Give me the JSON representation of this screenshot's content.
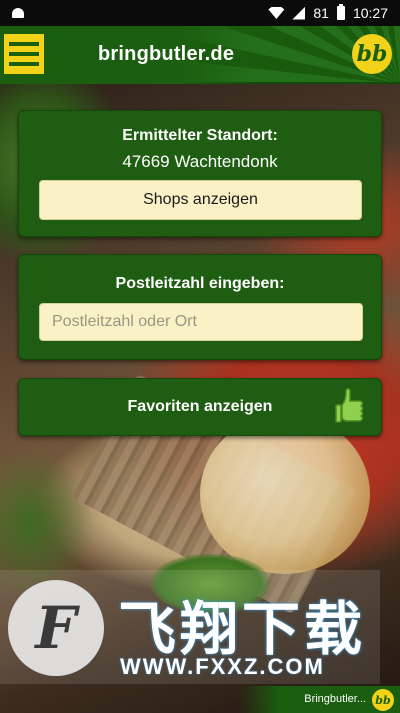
{
  "status_bar": {
    "battery": "81",
    "time": "10:27"
  },
  "header": {
    "title": "bringbutler.de",
    "logo_text": "bb"
  },
  "location_card": {
    "title": "Ermittelter Standort:",
    "location": "47669 Wachtendonk",
    "button_label": "Shops anzeigen"
  },
  "plz_card": {
    "title": "Postleitzahl eingeben:",
    "input_placeholder": "Postleitzahl oder Ort",
    "input_value": ""
  },
  "favorites_card": {
    "label": "Favoriten anzeigen"
  },
  "watermark": {
    "chinese_text": "飞翔下载",
    "url": "WWW.FXXZ.COM"
  },
  "footer": {
    "text": "Bringbutler...",
    "logo_text": "bb"
  },
  "colors": {
    "brand_green": "#1b5e0f",
    "brand_yellow": "#f2d31a",
    "input_bg": "#faf2c6"
  }
}
